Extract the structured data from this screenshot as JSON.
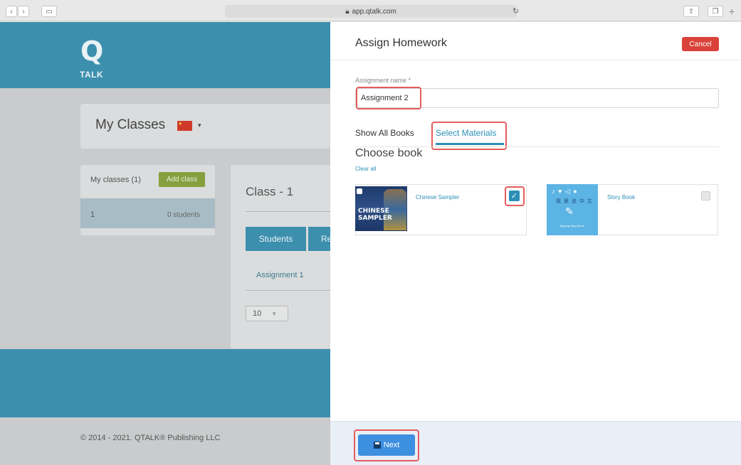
{
  "browser": {
    "url": "app.qtalk.com",
    "lock_icon": "lock-icon"
  },
  "background": {
    "logo_q": "Q",
    "logo_talk": "TALK",
    "page_title": "My Classes",
    "flag_caret": "▾",
    "classes_label": "My classes (1)",
    "add_class_label": "Add class",
    "class_item": {
      "number": "1",
      "students": "0 students"
    },
    "class_title": "Class - 1",
    "tabs": {
      "students": "Students",
      "second_partial": "Re"
    },
    "assignment_item": "Assignment 1",
    "page_size": "10",
    "footer_copyright": "© 2014 - 2021. QTALK® Publishing LLC"
  },
  "modal": {
    "title": "Assign Homework",
    "cancel_label": "Cancel",
    "field_label": "Assignment name *",
    "assignment_name": "Assignment 2",
    "tabs": {
      "all_books": "Show All Books",
      "select_materials": "Select Materials"
    },
    "choose_book_title": "Choose book",
    "clear_all_label": "Clear all",
    "books": [
      {
        "name": "Chinese Sampler",
        "cover_line1": "CHINESE",
        "cover_line2": "SAMPLER",
        "selected": true
      },
      {
        "name": "Story Book",
        "cover_han": "我 爱 说 中 文",
        "cover_sub": "Tapping Story Book",
        "selected": false
      }
    ],
    "next_label": "Next"
  },
  "colors": {
    "brand_blue": "#3d8fae",
    "accent_blue": "#2b8fb5",
    "cancel_red": "#d9433a",
    "highlight_red": "#e45c5c",
    "add_class_green": "#87a03f",
    "next_blue": "#3d8fe0"
  }
}
